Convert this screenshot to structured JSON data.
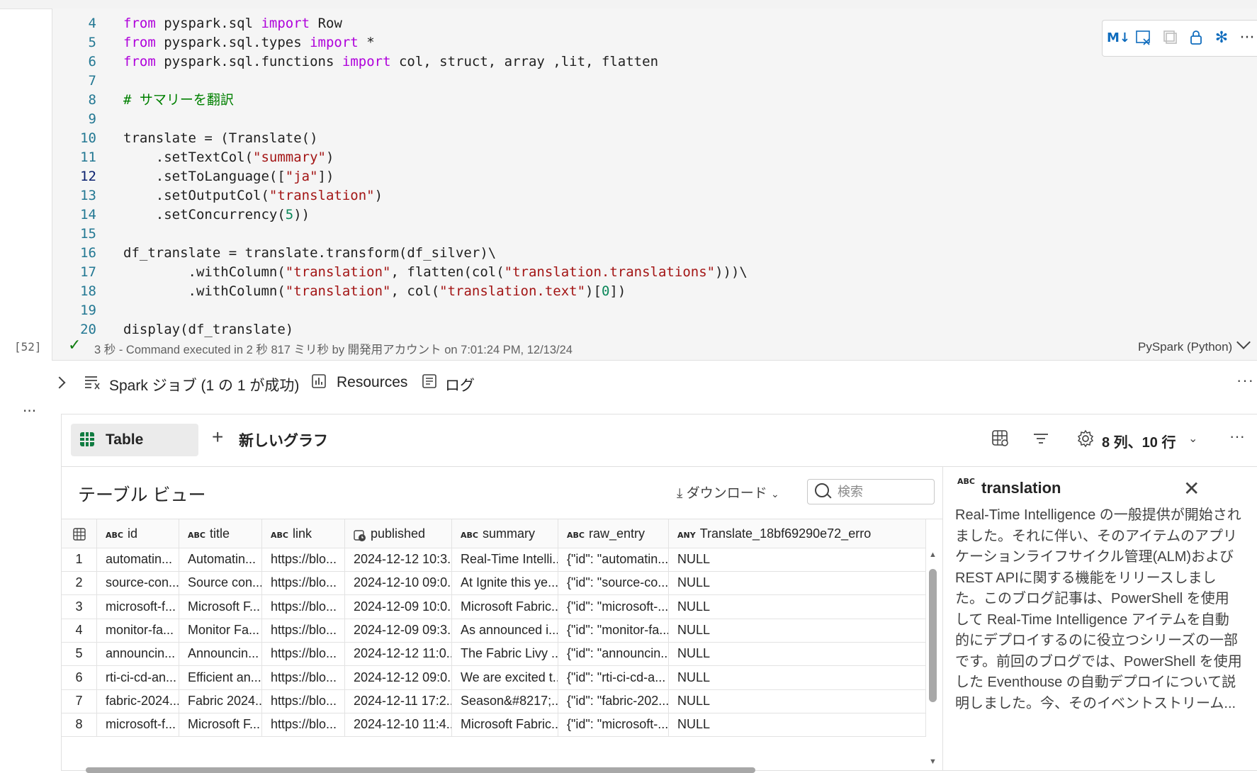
{
  "code": {
    "lines": [
      {
        "no": "4",
        "html": "<span class=\"kw\">from</span> pyspark.sql <span class=\"kw\">import</span> Row"
      },
      {
        "no": "5",
        "html": "<span class=\"kw\">from</span> pyspark.sql.types <span class=\"kw\">import</span> *"
      },
      {
        "no": "6",
        "html": "<span class=\"kw\">from</span> pyspark.sql.functions <span class=\"kw\">import</span> col, struct, array ,lit, flatten"
      },
      {
        "no": "7",
        "html": ""
      },
      {
        "no": "8",
        "html": "<span class=\"com\"># サマリーを翻訳</span>"
      },
      {
        "no": "9",
        "html": ""
      },
      {
        "no": "10",
        "html": "translate = (Translate()"
      },
      {
        "no": "11",
        "html": "    .setTextCol(<span class=\"str\">\"summary\"</span>)"
      },
      {
        "no": "12",
        "html": "    .setToLanguage([<span class=\"str\">\"ja\"</span>])",
        "current": true
      },
      {
        "no": "13",
        "html": "    .setOutputCol(<span class=\"str\">\"translation\"</span>)"
      },
      {
        "no": "14",
        "html": "    .setConcurrency(<span class=\"num\">5</span>))"
      },
      {
        "no": "15",
        "html": ""
      },
      {
        "no": "16",
        "html": "df_translate = translate.transform(df_silver)\\"
      },
      {
        "no": "17",
        "html": "        .withColumn(<span class=\"str\">\"translation\"</span>, flatten(col(<span class=\"str\">\"translation.translations\"</span>)))\\"
      },
      {
        "no": "18",
        "html": "        .withColumn(<span class=\"str\">\"translation\"</span>, col(<span class=\"str\">\"translation.text\"</span>)[<span class=\"num\">0</span>])"
      },
      {
        "no": "19",
        "html": ""
      },
      {
        "no": "20",
        "html": "display(df_translate)"
      }
    ]
  },
  "cell_toolbar": {
    "icons": [
      "markdown-toggle-icon",
      "clear-output-icon",
      "copy-icon",
      "lock-icon",
      "freeze-icon",
      "more-icon",
      "delete-icon"
    ]
  },
  "status": {
    "exec_count": "[52]",
    "text": "3 秒 - Command executed in 2 秒 817 ミリ秒 by 開発用アカウント on 7:01:24 PM, 12/13/24",
    "language": "PySpark (Python)"
  },
  "jobs": {
    "spark_jobs": "Spark ジョブ (1 の 1 が成功)",
    "resources": "Resources",
    "log": "ログ"
  },
  "output": {
    "table_tab": "Table",
    "new_chart": "新しいグラフ",
    "cols_rows": "8 列、10 行",
    "table_view_title": "テーブル ビュー",
    "download": "ダウンロード",
    "search_placeholder": "検索",
    "columns": [
      {
        "type": "ABC",
        "name": "id"
      },
      {
        "type": "ABC",
        "name": "title"
      },
      {
        "type": "ABC",
        "name": "link"
      },
      {
        "type": "clock",
        "name": "published"
      },
      {
        "type": "ABC",
        "name": "summary"
      },
      {
        "type": "ABC",
        "name": "raw_entry"
      },
      {
        "type": "ANY",
        "name": "Translate_18bf69290e72_erro"
      }
    ],
    "rows": [
      [
        "1",
        "automatin...",
        "Automatin...",
        "https://blo...",
        "2024-12-12 10:3...",
        "Real-Time Intelli...",
        "{\"id\": \"automatin...",
        "NULL"
      ],
      [
        "2",
        "source-con...",
        "Source con...",
        "https://blo...",
        "2024-12-10 09:0...",
        "At Ignite this ye...",
        "{\"id\": \"source-co...",
        "NULL"
      ],
      [
        "3",
        "microsoft-f...",
        "Microsoft F...",
        "https://blo...",
        "2024-12-09 10:0...",
        "Microsoft Fabric...",
        "{\"id\": \"microsoft-...",
        "NULL"
      ],
      [
        "4",
        "monitor-fa...",
        "Monitor Fa...",
        "https://blo...",
        "2024-12-09 09:3...",
        "As announced i...",
        "{\"id\": \"monitor-fa...",
        "NULL"
      ],
      [
        "5",
        "announcin...",
        "Announcin...",
        "https://blo...",
        "2024-12-12 11:0...",
        "The Fabric Livy ...",
        "{\"id\": \"announcin...",
        "NULL"
      ],
      [
        "6",
        "rti-ci-cd-an...",
        "Efficient an...",
        "https://blo...",
        "2024-12-12 09:0...",
        "We are excited t...",
        "{\"id\": \"rti-ci-cd-a...",
        "NULL"
      ],
      [
        "7",
        "fabric-2024...",
        "Fabric 2024...",
        "https://blo...",
        "2024-12-11 17:2...",
        "Season&#8217;...",
        "{\"id\": \"fabric-202...",
        "NULL"
      ],
      [
        "8",
        "microsoft-f...",
        "Microsoft F...",
        "https://blo...",
        "2024-12-10 11:4...",
        "Microsoft Fabric...",
        "{\"id\": \"microsoft-...",
        "NULL"
      ]
    ],
    "side_panel": {
      "type": "ABC",
      "title": "translation",
      "body": "Real-Time Intelligence の一般提供が開始されました。それに伴い、そのアイテムのアプリケーションライフサイクル管理(ALM)およびREST APIに関する機能をリリースしました。このブログ記事は、PowerShell を使用して Real-Time Intelligence アイテムを自動的にデプロイするのに役立つシリーズの一部です。前回のブログでは、PowerShell を使用した Eventhouse の自動デプロイについて説明しました。今、そのイベントストリーム..."
    }
  },
  "colors": {
    "accent": "#0f6cbd",
    "success": "#107c10",
    "table_icon": "#107c41"
  }
}
